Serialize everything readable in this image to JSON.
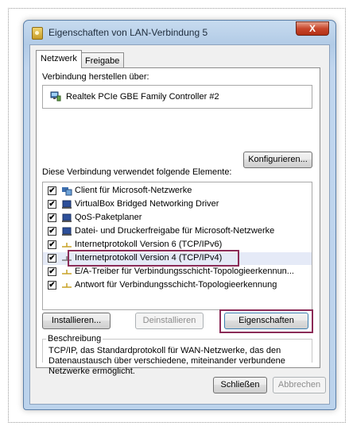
{
  "window": {
    "title": "Eigenschaften von LAN-Verbindung 5",
    "close_label": "X"
  },
  "tabs": [
    {
      "label": "Netzwerk",
      "active": true
    },
    {
      "label": "Freigabe",
      "active": false
    }
  ],
  "connect_via": {
    "label": "Verbindung herstellen über:",
    "adapter": "Realtek PCIe GBE Family Controller #2",
    "configure_button": "Konfigurieren..."
  },
  "components": {
    "label": "Diese Verbindung verwendet folgende Elemente:",
    "items": [
      {
        "text": "Client für Microsoft-Netzwerke",
        "checked": true,
        "icon": "network-client-icon"
      },
      {
        "text": "VirtualBox Bridged Networking Driver",
        "checked": true,
        "icon": "service-icon"
      },
      {
        "text": "QoS-Paketplaner",
        "checked": true,
        "icon": "service-icon"
      },
      {
        "text": "Datei- und Druckerfreigabe für Microsoft-Netzwerke",
        "checked": true,
        "icon": "service-icon"
      },
      {
        "text": "Internetprotokoll Version 6 (TCP/IPv6)",
        "checked": true,
        "icon": "protocol-icon"
      },
      {
        "text": "Internetprotokoll Version 4 (TCP/IPv4)",
        "checked": true,
        "icon": "protocol-icon"
      },
      {
        "text": "E/A-Treiber für Verbindungsschicht-Topologieerkennun...",
        "checked": true,
        "icon": "protocol-icon"
      },
      {
        "text": "Antwort für Verbindungsschicht-Topologieerkennung",
        "checked": true,
        "icon": "protocol-icon"
      }
    ],
    "selected_index": 5
  },
  "buttons": {
    "install": "Installieren...",
    "uninstall": "Deinstallieren",
    "properties": "Eigenschaften",
    "close": "Schließen",
    "cancel": "Abbrechen"
  },
  "description": {
    "title": "Beschreibung",
    "text": "TCP/IP, das Standardprotokoll für WAN-Netzwerke, das den Datenaustausch über verschiedene, miteinander verbundene Netzwerke ermöglicht."
  },
  "colors": {
    "highlight_frame": "#8b2b57",
    "selection": "#e5eaf7"
  }
}
